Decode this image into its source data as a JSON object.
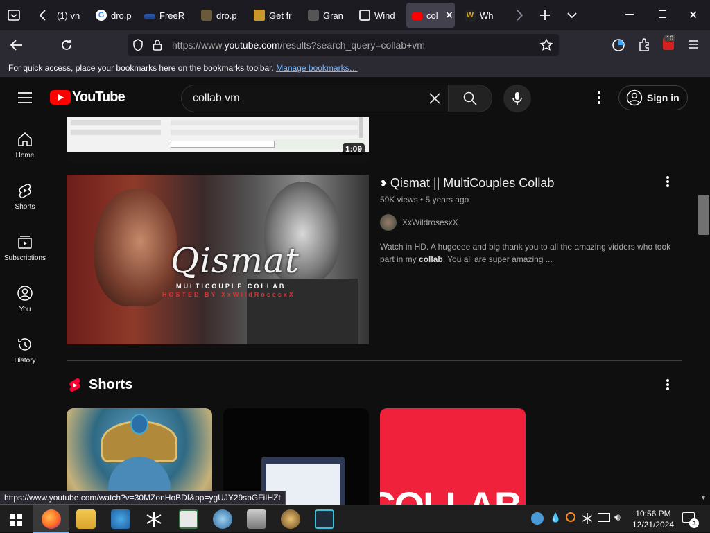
{
  "browser": {
    "tabs": [
      {
        "label": "(1) vn",
        "icon": "tab-icon-generic"
      },
      {
        "label": "dro.p",
        "icon": "google-icon"
      },
      {
        "label": "FreeR",
        "icon": "freer-icon"
      },
      {
        "label": "dro.p",
        "icon": "page-icon"
      },
      {
        "label": "Get fr",
        "icon": "gift-icon"
      },
      {
        "label": "Gran",
        "icon": "gran-icon"
      },
      {
        "label": "Wind",
        "icon": "windows-icon"
      },
      {
        "label": "col",
        "icon": "youtube-icon"
      },
      {
        "label": "Wh",
        "icon": "w-icon"
      }
    ],
    "url_prefix": "https://www.",
    "url_domain": "youtube.com",
    "url_rest": "/results?search_query=collab+vm",
    "extension_badge": "10",
    "bookmarks_hint": "For quick access, place your bookmarks here on the bookmarks toolbar.",
    "bookmarks_link": "Manage bookmarks…",
    "status_url": "https://www.youtube.com/watch?v=30MZonHoBDI&pp=ygUJY29sbGFiIHZt"
  },
  "youtube": {
    "logo_text": "YouTube",
    "search_value": "collab vm",
    "sign_in": "Sign in",
    "sidebar": [
      {
        "label": "Home",
        "icon": "home-icon"
      },
      {
        "label": "Shorts",
        "icon": "shorts-icon"
      },
      {
        "label": "Subscriptions",
        "icon": "subscriptions-icon"
      },
      {
        "label": "You",
        "icon": "you-icon"
      },
      {
        "label": "History",
        "icon": "history-icon"
      }
    ],
    "prev_video_duration": "1:09",
    "video": {
      "title": "Qismat || MultiCouples Collab",
      "views": "59K views",
      "age": "5 years ago",
      "channel": "XxWildrosesxX",
      "description_pre": "Watch in HD. A hugeeee and big thank you to all the amazing vidders who took part in my ",
      "description_bold": "collab",
      "description_post": ", You all are super amazing ...",
      "thumb_title": "Qismat",
      "thumb_sub1": "MULTICOUPLE COLLAB",
      "thumb_sub2": "HOSTED BY XxWildRosesxX"
    },
    "shorts_heading": "Shorts",
    "shorts_card3_text": "COLLAB"
  },
  "taskbar": {
    "time": "10:56 PM",
    "date": "12/21/2024",
    "notifications": "3"
  },
  "colors": {
    "yt_red": "#ff0000",
    "bg": "#0f0f0f",
    "link": "#7ab8ff"
  }
}
